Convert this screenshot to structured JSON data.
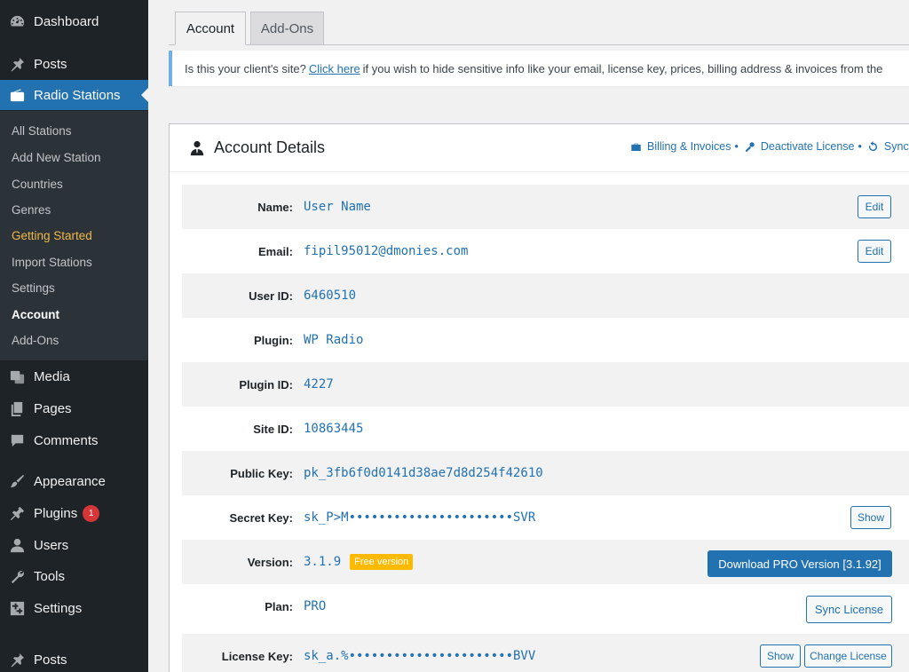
{
  "sidebar": {
    "top_items": [
      {
        "label": "Dashboard",
        "icon": "dashboard-icon"
      },
      {
        "label": "Posts",
        "icon": "pushpin-icon"
      },
      {
        "label": "Radio Stations",
        "icon": "radio-icon"
      }
    ],
    "submenu": [
      {
        "label": "All Stations"
      },
      {
        "label": "Add New Station"
      },
      {
        "label": "Countries"
      },
      {
        "label": "Genres"
      },
      {
        "label": "Getting Started"
      },
      {
        "label": "Import Stations"
      },
      {
        "label": "Settings"
      },
      {
        "label": "Account"
      },
      {
        "label": "Add-Ons"
      }
    ],
    "bottom_items": [
      {
        "label": "Media",
        "icon": "media-icon"
      },
      {
        "label": "Pages",
        "icon": "pages-icon"
      },
      {
        "label": "Comments",
        "icon": "comments-icon"
      },
      {
        "label": "Appearance",
        "icon": "paintbrush-icon"
      },
      {
        "label": "Plugins",
        "icon": "plugins-icon",
        "badge": "1"
      },
      {
        "label": "Users",
        "icon": "users-icon"
      },
      {
        "label": "Tools",
        "icon": "wrench-icon"
      },
      {
        "label": "Settings",
        "icon": "settings-icon"
      },
      {
        "label": "Posts",
        "icon": "pushpin-icon"
      }
    ]
  },
  "tabs": [
    {
      "label": "Account",
      "active": true
    },
    {
      "label": "Add-Ons",
      "active": false
    }
  ],
  "notice": {
    "prefix": "Is this your client's site?",
    "link": "Click here",
    "suffix": "if you wish to hide sensitive info like your email, license key, prices, billing address & invoices from the"
  },
  "account": {
    "title": "Account Details",
    "links": {
      "billing": "Billing & Invoices",
      "deactivate": "Deactivate License",
      "sync": "Sync",
      "separator": "•"
    },
    "rows": [
      {
        "label": "Name:",
        "value": "User Name"
      },
      {
        "label": "Email:",
        "value": "fipil95012@dmonies.com"
      },
      {
        "label": "User ID:",
        "value": "6460510"
      },
      {
        "label": "Plugin:",
        "value": "WP Radio"
      },
      {
        "label": "Plugin ID:",
        "value": "4227"
      },
      {
        "label": "Site ID:",
        "value": "10863445"
      },
      {
        "label": "Public Key:",
        "value": "pk_3fb6f0d0141d38ae7d8d254f42610"
      },
      {
        "label": "Secret Key:",
        "value": "sk_P>M••••••••••••••••••••••SVR"
      },
      {
        "label": "Version:",
        "value": "3.1.9",
        "tag": "Free version"
      },
      {
        "label": "Plan:",
        "value": "PRO"
      },
      {
        "label": "License Key:",
        "value": "sk_a.%••••••••••••••••••••••BVV"
      }
    ],
    "buttons": {
      "edit": "Edit",
      "show": "Show",
      "download": "Download PRO Version [3.1.92]",
      "sync_license": "Sync License",
      "change_license": "Change License"
    }
  },
  "colors": {
    "sidebar_bg": "#1d2327",
    "submenu_bg": "#2c3338",
    "accent": "#2271b1",
    "highlight": "#f0b849",
    "badge": "#d63638",
    "free_tag": "#ffba00"
  }
}
